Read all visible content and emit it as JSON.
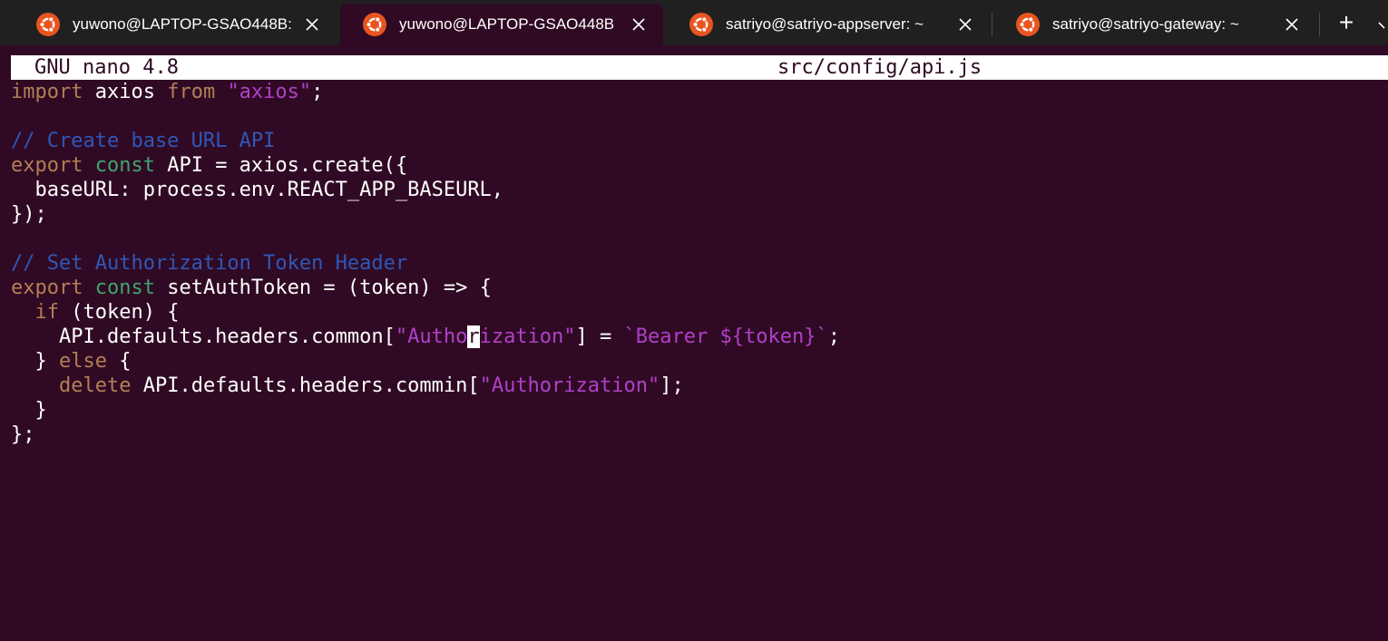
{
  "tabs": [
    {
      "label": "yuwono@LAPTOP-GSAO448B:",
      "icon": "ubuntu-icon",
      "active": false
    },
    {
      "label": "yuwono@LAPTOP-GSAO448B",
      "icon": "ubuntu-icon",
      "active": true
    },
    {
      "label": "satriyo@satriyo-appserver: ~",
      "icon": "ubuntu-icon",
      "active": false
    },
    {
      "label": "satriyo@satriyo-gateway: ~",
      "icon": "ubuntu-icon",
      "active": false
    }
  ],
  "tabbar": {
    "new_tab": "+",
    "new_tab_icon": "plus-icon",
    "dropdown_icon": "chevron-down-icon"
  },
  "nano": {
    "version": "GNU nano 4.8",
    "filename": "src/config/api.js"
  },
  "code": {
    "l1": {
      "kw": "import",
      "a": " axios ",
      "kw2": "from",
      "sp": " ",
      "str": "\"axios\"",
      "end": ";"
    },
    "l3": {
      "cm": "// Create base URL API"
    },
    "l4": {
      "kw": "export",
      "sp": " ",
      "ty": "const",
      "rest": " API = axios.create({"
    },
    "l5": {
      "text": "  baseURL: process.env.REACT_APP_BASEURL,"
    },
    "l6": {
      "text": "});"
    },
    "l8": {
      "cm": "// Set Authorization Token Header"
    },
    "l9": {
      "kw": "export",
      "sp": " ",
      "ty": "const",
      "rest": " setAuthToken = (token) => {"
    },
    "l10": {
      "ind": "  ",
      "kw": "if",
      "rest": " (token) {"
    },
    "l11": {
      "a": "    API.defaults.headers.common[",
      "s1": "\"Autho",
      "cur": "r",
      "s2": "ization\"",
      "b": "] = ",
      "tpl": "`Bearer ${token}`",
      "end": ";"
    },
    "l12": {
      "a": "  } ",
      "kw": "else",
      "rest": " {"
    },
    "l13": {
      "ind": "    ",
      "kw": "delete",
      "a": " API.defaults.headers.commin[",
      "str": "\"Authorization\"",
      "end": "];"
    },
    "l14": {
      "text": "  }"
    },
    "l15": {
      "text": "};"
    }
  },
  "colors": {
    "terminal_bg": "#300a24",
    "tabbar_bg": "#202020",
    "keyword": "#b47f55",
    "type": "#3fa56d",
    "string": "#b040c8",
    "comment": "#2f57b8",
    "ubuntu_orange": "#e95420"
  }
}
